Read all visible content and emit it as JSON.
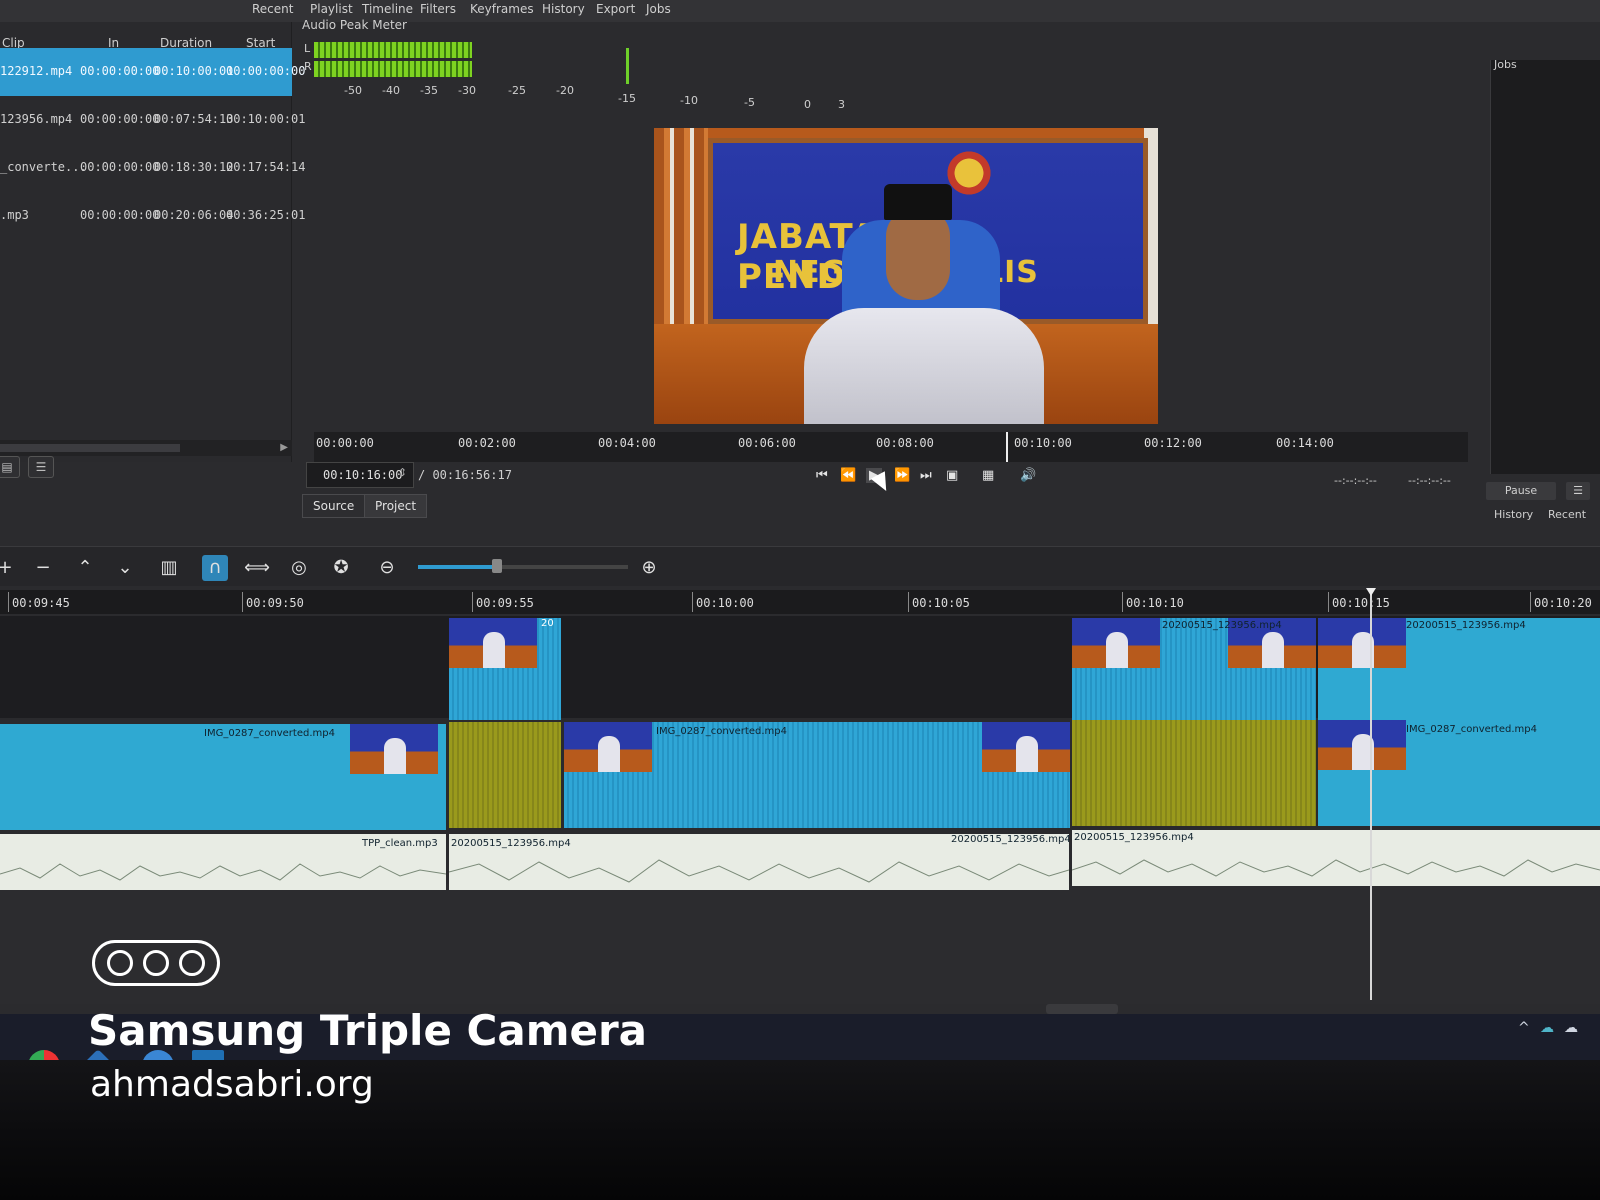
{
  "menu": [
    "Recent",
    "Playlist",
    "Timeline",
    "Filters",
    "Keyframes",
    "History",
    "Export",
    "Jobs"
  ],
  "playlist": {
    "columns": [
      "Clip",
      "In",
      "Duration",
      "Start"
    ],
    "rows": [
      {
        "clip": "122912.mp4",
        "in": "00:00:00:00",
        "duration": "00:10:00:01",
        "start": "00:00:00:00",
        "selected": true
      },
      {
        "clip": "123956.mp4",
        "in": "00:00:00:00",
        "duration": "00:07:54:13",
        "start": "00:10:00:01",
        "selected": false
      },
      {
        "clip": "_converte...",
        "in": "00:00:00:00",
        "duration": "00:18:30:12",
        "start": "00:17:54:14",
        "selected": false
      },
      {
        "clip": ".mp3",
        "in": "00:00:00:00",
        "duration": "00:20:06:04",
        "start": "00:36:25:01",
        "selected": false
      }
    ]
  },
  "meter": {
    "title": "Audio Peak Meter",
    "left": "L",
    "right": "R",
    "scale": [
      "-50",
      "-40",
      "-35",
      "-30",
      "-25",
      "-20",
      "-15",
      "-10",
      "-5",
      "0",
      "3"
    ]
  },
  "preview": {
    "banner_line1": "JABATAN PENDIDIKAN",
    "banner_line2": "NEGERI PERLIS",
    "scrub_labels": [
      "00:00:00",
      "00:02:00",
      "00:04:00",
      "00:06:00",
      "00:08:00",
      "00:10:00",
      "00:12:00",
      "00:14:00"
    ],
    "position_ratio": 0.6,
    "timecode": "00:10:16:00",
    "total": "/ 00:16:56:17",
    "tabs": {
      "source": "Source",
      "project": "Project"
    },
    "in_point": "--:--:--:--",
    "out_point": "--:--:--:--"
  },
  "jobs": {
    "title": "Jobs",
    "pause": "Pause",
    "menu": "☰",
    "tab_history": "History",
    "tab_recent": "Recent"
  },
  "icons": {
    "add": "+",
    "remove": "−",
    "lift": "⌃",
    "overwrite": "⌄",
    "split": "▥",
    "snap": "∩",
    "scrub": "⟺",
    "ripple": "◎",
    "ripple_all": "✪",
    "zoom_out": "⊖",
    "zoom_in": "⊕",
    "skip_start": "⏮",
    "rewind": "⏪",
    "play": "▶",
    "fast_forward": "⏩",
    "skip_end": "⏭",
    "zoom_view": "▣",
    "grid": "▦",
    "volume": "🔊",
    "list": "☰",
    "tiles": "▤",
    "arrow_right": "▶",
    "spinner": "⇕"
  },
  "timeline": {
    "ruler": [
      "00:09:45",
      "00:09:50",
      "00:09:55",
      "00:10:00",
      "00:10:05",
      "00:10:10",
      "00:10:15",
      "00:10:20"
    ],
    "v2_clips": [
      "20",
      "20200515_123956.mp4",
      "20200515_123956.mp4"
    ],
    "v1_clips": [
      "IMG_0287_converted.mp4",
      "IMG_0287_converted.mp4",
      "IMG_0287_converted.mp4"
    ],
    "a1_clips": [
      "TPP_clean.mp3",
      "20200515_123956.mp4",
      "20200515_123956.mp4",
      "20200515_123956.mp4"
    ]
  },
  "watermark": {
    "title": "Samsung Triple Camera",
    "site": "ahmadsabri.org"
  },
  "colors": {
    "selection": "#2f9bd0",
    "video_clip": "#2fa6d6",
    "gap_clip": "#9a9a1c",
    "audio_clip": "#e8ece4",
    "meter_green": "#7ed321"
  }
}
